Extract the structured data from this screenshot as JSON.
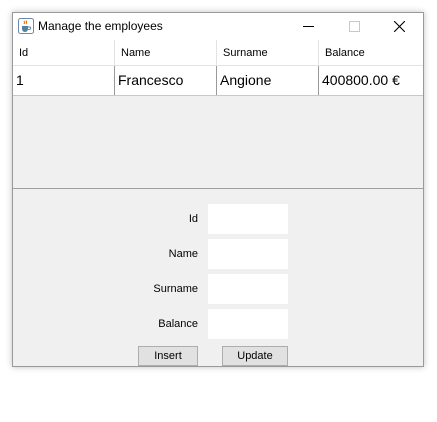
{
  "window": {
    "title": "Manage the employees"
  },
  "table": {
    "columns": [
      "Id",
      "Name",
      "Surname",
      "Balance"
    ],
    "rows": [
      {
        "id": "1",
        "name": "Francesco",
        "surname": "Angione",
        "balance": "400800.00 €"
      }
    ]
  },
  "form": {
    "id_label": "Id",
    "name_label": "Name",
    "surname_label": "Surname",
    "balance_label": "Balance",
    "id_value": "",
    "name_value": "",
    "surname_value": "",
    "balance_value": ""
  },
  "buttons": {
    "insert_label": "Insert",
    "update_label": "Update"
  },
  "icons": {
    "app": "java-cup-icon",
    "minimize": "minimize-icon",
    "maximize": "maximize-icon",
    "close": "close-icon"
  }
}
